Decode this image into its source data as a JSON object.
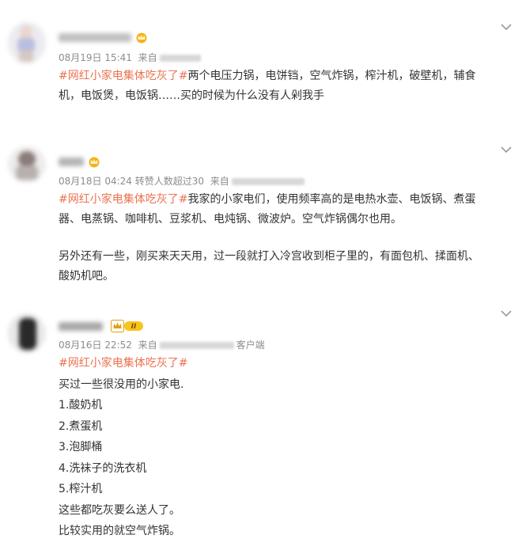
{
  "colors": {
    "accent": "#eb7350",
    "text": "#333333",
    "meta": "#8c8c8c",
    "chevron": "#999999"
  },
  "posts": [
    {
      "meta": {
        "date": "08月19日 15:41",
        "from": "来自"
      },
      "badge_icon": "crown-badge-icon",
      "lines": [
        {
          "tag": "#网红小家电集体吃灰了#",
          "text": "两个电压力锅，电饼铛，空气炸锅，榨汁机，破壁机，辅食"
        },
        {
          "text": "机，电饭煲，电饭锅……买的时候为什么没有人剁我手"
        }
      ]
    },
    {
      "meta": {
        "date": "08月18日 04:24",
        "extra": "转赞人数超过30",
        "from": "来自"
      },
      "badge_icon": "crown-badge-icon",
      "lines": [
        {
          "tag": "#网红小家电集体吃灰了#",
          "text": "我家的小家电们，使用频率高的是电热水壶、电饭锅、煮蛋"
        },
        {
          "text": "器、电蒸锅、咖啡机、豆浆机、电炖锅、微波炉。空气炸锅偶尔也用。"
        },
        {
          "text": "另外还有一些，刚买来天天用，过一段就打入冷宫收到柜子里的，有面包机、揉面机、"
        },
        {
          "text": "酸奶机吧。"
        }
      ]
    },
    {
      "meta": {
        "date": "08月16日 22:52",
        "from": "来自",
        "suffix": "客户端"
      },
      "badge_icon": "vip-level-badge-icon",
      "badge_level": "II",
      "lines": [
        {
          "tag": "#网红小家电集体吃灰了#",
          "text": ""
        },
        {
          "text": "买过一些很没用的小家电."
        },
        {
          "text": "1.酸奶机"
        },
        {
          "text": "2.煮蛋机"
        },
        {
          "text": "3.泡脚桶"
        },
        {
          "text": "4.洗袜子的洗衣机"
        },
        {
          "text": "5.榨汁机"
        },
        {
          "text": "这些都吃灰要么送人了。"
        },
        {
          "text": "比较实用的就空气炸锅。"
        }
      ]
    }
  ]
}
